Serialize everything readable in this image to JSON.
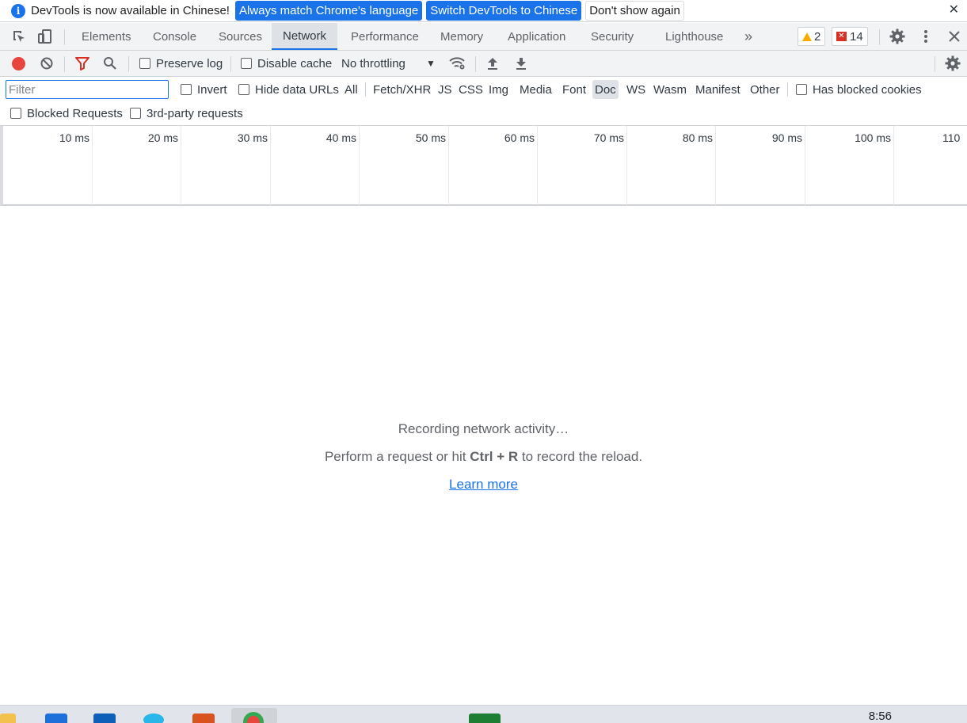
{
  "infobar": {
    "message": "DevTools is now available in Chinese!",
    "btn_match": "Always match Chrome's language",
    "btn_switch": "Switch DevTools to Chinese",
    "btn_dismiss": "Don't show again",
    "close_glyph": "✕"
  },
  "tabs": {
    "elements": "Elements",
    "console": "Console",
    "sources": "Sources",
    "network": "Network",
    "performance": "Performance",
    "memory": "Memory",
    "application": "Application",
    "security": "Security",
    "lighthouse": "Lighthouse",
    "more": "»",
    "warnings_count": "2",
    "errors_count": "14",
    "active": "Network"
  },
  "toolbar": {
    "preserve_log": "Preserve log",
    "disable_cache": "Disable cache",
    "throttling": "No throttling",
    "throttling_arrow": "▼"
  },
  "filter": {
    "placeholder": "Filter",
    "invert": "Invert",
    "hide_data_urls": "Hide data URLs",
    "types": [
      "All",
      "Fetch/XHR",
      "JS",
      "CSS",
      "Img",
      "Media",
      "Font",
      "Doc",
      "WS",
      "Wasm",
      "Manifest",
      "Other"
    ],
    "selected_type": "Doc",
    "has_blocked_cookies": "Has blocked cookies",
    "blocked_requests": "Blocked Requests",
    "third_party": "3rd-party requests"
  },
  "timeline": {
    "ticks": [
      "10 ms",
      "20 ms",
      "30 ms",
      "40 ms",
      "50 ms",
      "60 ms",
      "70 ms",
      "80 ms",
      "90 ms",
      "100 ms",
      "110"
    ]
  },
  "empty_state": {
    "recording": "Recording network activity…",
    "hint_prefix": "Perform a request or hit ",
    "hint_keys": "Ctrl + R",
    "hint_suffix": " to record the reload.",
    "learn_more": "Learn more"
  },
  "taskbar": {
    "clock": "8:56"
  },
  "colors": {
    "accent": "#1a73e8",
    "record_red": "#e8453c",
    "warning": "#f9ab00",
    "error": "#d93025"
  }
}
